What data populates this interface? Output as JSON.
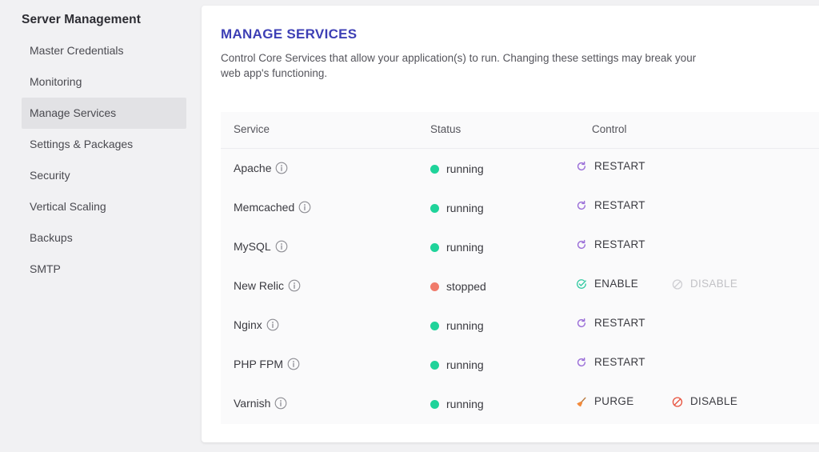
{
  "sidebar": {
    "title": "Server Management",
    "items": [
      {
        "label": "Master Credentials",
        "active": false
      },
      {
        "label": "Monitoring",
        "active": false
      },
      {
        "label": "Manage Services",
        "active": true
      },
      {
        "label": "Settings & Packages",
        "active": false
      },
      {
        "label": "Security",
        "active": false
      },
      {
        "label": "Vertical Scaling",
        "active": false
      },
      {
        "label": "Backups",
        "active": false
      },
      {
        "label": "SMTP",
        "active": false
      }
    ]
  },
  "main": {
    "title": "MANAGE SERVICES",
    "description": "Control Core Services that allow your application(s) to run. Changing these settings may break your web app's functioning.",
    "columns": [
      "Service",
      "Status",
      "Control"
    ],
    "services": [
      {
        "name": "Apache",
        "status": "running",
        "controls": [
          {
            "label": "RESTART",
            "icon": "restart-icon",
            "enabled": true
          }
        ]
      },
      {
        "name": "Memcached",
        "status": "running",
        "controls": [
          {
            "label": "RESTART",
            "icon": "restart-icon",
            "enabled": true
          }
        ]
      },
      {
        "name": "MySQL",
        "status": "running",
        "controls": [
          {
            "label": "RESTART",
            "icon": "restart-icon",
            "enabled": true
          }
        ]
      },
      {
        "name": "New Relic",
        "status": "stopped",
        "controls": [
          {
            "label": "ENABLE",
            "icon": "check-circle-icon",
            "enabled": true
          },
          {
            "label": "DISABLE",
            "icon": "disable-icon",
            "enabled": false
          }
        ]
      },
      {
        "name": "Nginx",
        "status": "running",
        "controls": [
          {
            "label": "RESTART",
            "icon": "restart-icon",
            "enabled": true
          }
        ]
      },
      {
        "name": "PHP FPM",
        "status": "running",
        "controls": [
          {
            "label": "RESTART",
            "icon": "restart-icon",
            "enabled": true
          }
        ]
      },
      {
        "name": "Varnish",
        "status": "running",
        "controls": [
          {
            "label": "PURGE",
            "icon": "broom-icon",
            "enabled": true
          },
          {
            "label": "DISABLE",
            "icon": "disable-icon",
            "enabled": true
          }
        ]
      }
    ]
  },
  "colors": {
    "title": "#3d3fb5",
    "running": "#1fd39a",
    "stopped": "#f07b6b",
    "restart_icon": "#9b6fd8",
    "enable_icon": "#2fc9a0",
    "disable_icon_active": "#e8533f",
    "disable_icon_inactive": "#cfcfd3",
    "purge_icon": "#f28a3c"
  }
}
